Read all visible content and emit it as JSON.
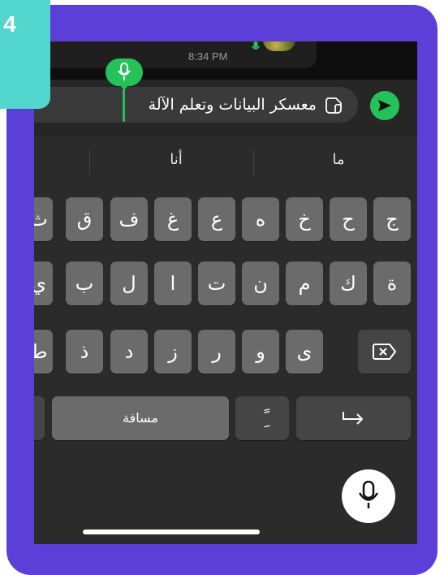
{
  "step": {
    "number": "4"
  },
  "chat": {
    "time": "8:34 PM"
  },
  "input": {
    "text": "معسكر البيانات وتعلم الآلة"
  },
  "suggestions": [
    "أنا",
    "ما"
  ],
  "keyboard": {
    "row1": [
      "ث",
      "ق",
      "ف",
      "غ",
      "ع",
      "ه",
      "خ",
      "ح",
      "ج"
    ],
    "row2": [
      "ي",
      "ب",
      "ل",
      "ا",
      "ت",
      "ن",
      "م",
      "ك",
      "ة"
    ],
    "row3": [
      "ط",
      "ذ",
      "د",
      "ز",
      "ر",
      "و",
      "ى"
    ],
    "space_label": "مسافة",
    "diacritic_label": "ًِ"
  },
  "colors": {
    "frame": "#5b3fd8",
    "badge": "#52d6cd",
    "accent_green": "#25c25a",
    "keyboard_bg": "#2b2b2b",
    "key": "#6b6b6b"
  }
}
